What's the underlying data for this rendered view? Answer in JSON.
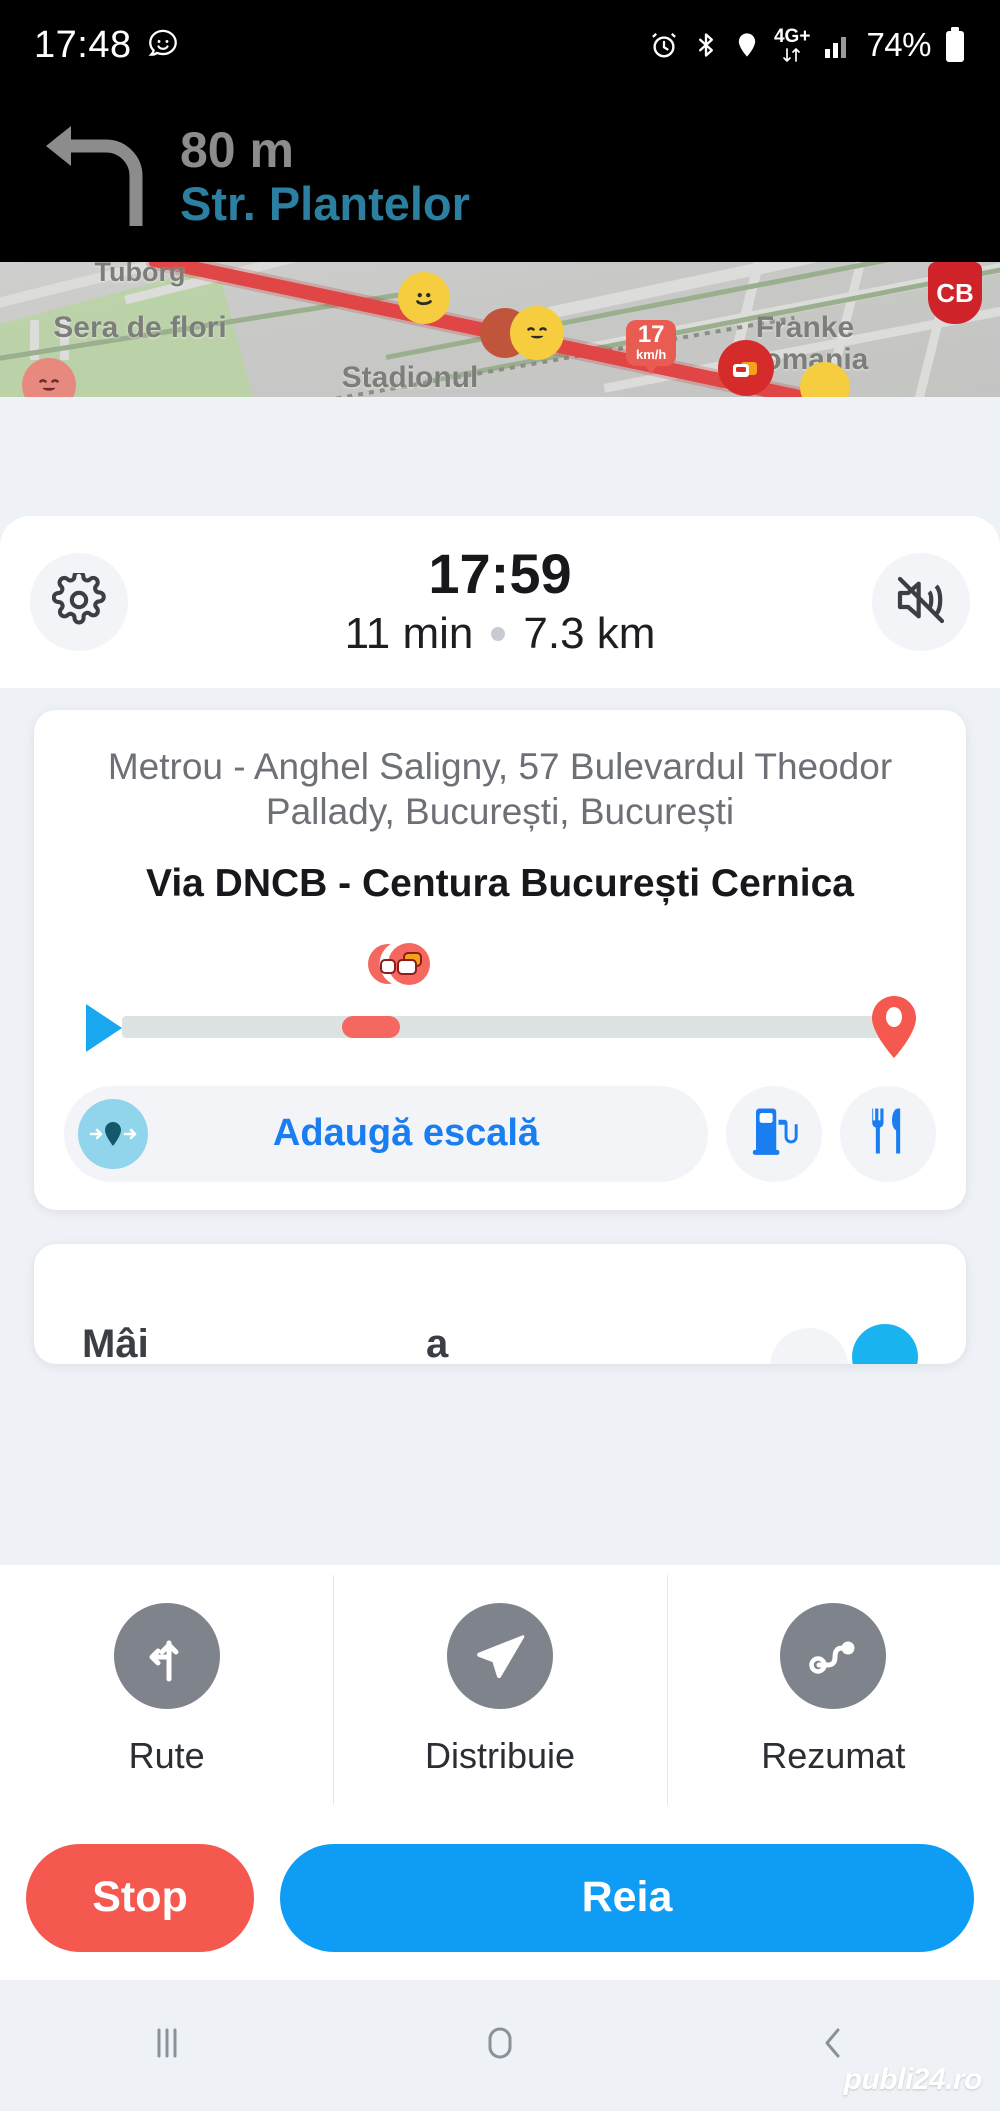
{
  "status_bar": {
    "time": "17:48",
    "app_icon": "waze-icon",
    "icons": [
      "alarm-icon",
      "bluetooth-icon",
      "location-icon",
      "network-4gplus-icon",
      "signal-bars-icon"
    ],
    "network_label": "4G+",
    "battery_percent": "74%"
  },
  "nav_instruction": {
    "maneuver_icon": "turn-left-icon",
    "distance": "80 m",
    "street": "Str. Plantelor"
  },
  "map": {
    "labels": [
      {
        "text": "Tuborg"
      },
      {
        "text": "Sera de flori"
      },
      {
        "text": "Stadionul"
      },
      {
        "text": "Franke Romania"
      }
    ],
    "speed_value": "17",
    "speed_unit": "km/h",
    "shield_label": "CB",
    "mood_icons": [
      "waze-mood-sword-icon",
      "waze-mood-king-icon",
      "waze-mood-laugh-icon",
      "waze-mood-blush-icon"
    ],
    "traffic_icon": "traffic-jam-icon"
  },
  "eta": {
    "settings_icon": "gear-icon",
    "mute_icon": "sound-muted-icon",
    "arrival_time": "17:59",
    "duration": "11 min",
    "distance": "7.3 km"
  },
  "route_card": {
    "destination": "Metrou - Anghel Saligny, 57 Bulevardul Theodor Pallady, București, București",
    "via": "Via DNCB - Centura București Cernica",
    "progress": {
      "start_icon": "current-position-arrow-icon",
      "end_icon": "destination-pin-icon",
      "jam_icon": "traffic-jam-pin-icon",
      "jam_start_percent": 34,
      "jam_width_percent": 10,
      "jam_marker_percent": 45
    },
    "add_stop_label": "Adaugă escală",
    "add_stop_icon": "add-waypoint-icon",
    "gas_icon": "gas-station-icon",
    "food_icon": "restaurant-icon"
  },
  "partial_card": {
    "ghost_text_1": "Mâi",
    "ghost_text_2": "a"
  },
  "actions": [
    {
      "label": "Rute",
      "icon": "routes-fork-icon"
    },
    {
      "label": "Distribuie",
      "icon": "share-paper-plane-icon"
    },
    {
      "label": "Rezumat",
      "icon": "route-summary-icon"
    }
  ],
  "cta": {
    "stop_label": "Stop",
    "resume_label": "Reia"
  },
  "android_nav": {
    "recents_icon": "recents-icon",
    "home_icon": "home-icon",
    "back_icon": "back-icon"
  },
  "watermark": "publi24.ro",
  "colors": {
    "accent_blue": "#0e9cf5",
    "street_blue": "#2b7fa0",
    "stop_red": "#f4584f",
    "traffic_red": "#f4685f",
    "gray_icon": "#7f838b",
    "bg": "#eef1f5"
  }
}
